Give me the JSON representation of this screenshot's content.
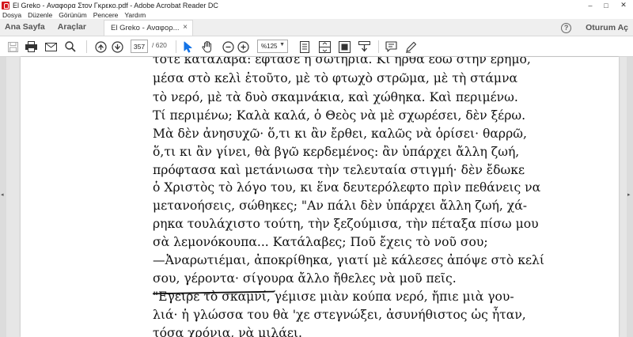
{
  "window": {
    "title": "El Greko - Αναφορα Στον Γκρεκο.pdf - Adobe Acrobat Reader DC",
    "controls": {
      "minimize": "–",
      "maximize": "□",
      "close": "✕"
    }
  },
  "menu": [
    "Dosya",
    "Düzenle",
    "Görünüm",
    "Pencere",
    "Yardım"
  ],
  "tabs": {
    "home": "Ana Sayfa",
    "tools": "Araçlar",
    "document": "El Greko - Αναφορ...",
    "close_glyph": "×"
  },
  "header_right": {
    "help": "?",
    "sign_in": "Oturum Aç"
  },
  "toolbar": {
    "current_page": "357",
    "total_pages": "/ 620",
    "zoom": "%125",
    "zoom_dropdown": "▼"
  },
  "icons": {
    "save": "save-icon",
    "print": "print-icon",
    "email": "email-icon",
    "search": "search-icon",
    "prev_page": "arrow-up-circle-icon",
    "next_page": "arrow-down-circle-icon",
    "select": "cursor-arrow-icon",
    "hand": "hand-icon",
    "zoom_out": "zoom-out-icon",
    "zoom_in": "zoom-in-icon",
    "comment": "comment-icon",
    "highlight": "pen-icon",
    "accent": "#1473e6"
  },
  "panels": {
    "left_arrow": "◂",
    "right_arrow": "▸"
  },
  "document": {
    "lines": [
      "τότε κατάλαβα: έφτασε η σωτηρία. Κι ήρθα εδώ στην έρημο,",
      "μέσα στὸ κελὶ ἐτοῦτο, μὲ τὸ φτωχὸ στρῶμα, μὲ τὴ στάμνα",
      "τὸ νερό, μὲ τὰ δυὸ σκαμνάκια, καὶ χώθηκα. Καὶ περιμένω.",
      "Τί περιμένω; Καλὰ καλά, ὁ Θεὸς νὰ μὲ σχωρέσει, δὲν ξέρω.",
      "Μὰ δὲν ἀνησυχῶ· ὅ,τι κι ἂν ἔρθει, καλῶς νὰ ὁρίσει· θαρρῶ,",
      "ὅ,τι κι ἂν γίνει, θὰ βγῶ κερδεμένος: ἂν ὑπάρχει ἄλλη ζωή,",
      "πρόφτασα καὶ μετάνιωσα τὴν τελευταία στιγμή· δὲν ἔδωκε",
      "ὁ Χριστὸς τὸ λόγο του, κι ἕνα δευτερόλεφτο πρὶν πεθάνεις να",
      "μετανοήσεις, σώθηκες; \"Αν πάλι δὲν ὑπάρχει ἄλλη ζωή, χά-",
      "ρηκα τουλάχιστο τούτη, τὴν ξεζούμισα, τὴν πέταξα πίσω μου",
      "σὰ λεμονόκουπα... Κατάλαβες; Ποῦ ἔχεις τὸ νοῦ σου;",
      "—Ἀναρωτιέμαι, ἀποκρίθηκα, γιατί μὲ κάλεσες ἀπόψε στὸ κελί",
      "σου, γέροντα· σίγουρα ἄλλο ἤθελες νὰ μοῦ πεῖς.",
      "\"Εγειρε τὸ σκαμνί, γέμισε μιὰν κούπα νερό, ἤπιε μιὰ γου-",
      "λιά· ἡ γλώσσα του θὰ 'χε στεγνώξει, ἀσυνήθιστος ὡς ἦταν,",
      "τόσα χρόνια, νὰ μιλάει."
    ]
  }
}
